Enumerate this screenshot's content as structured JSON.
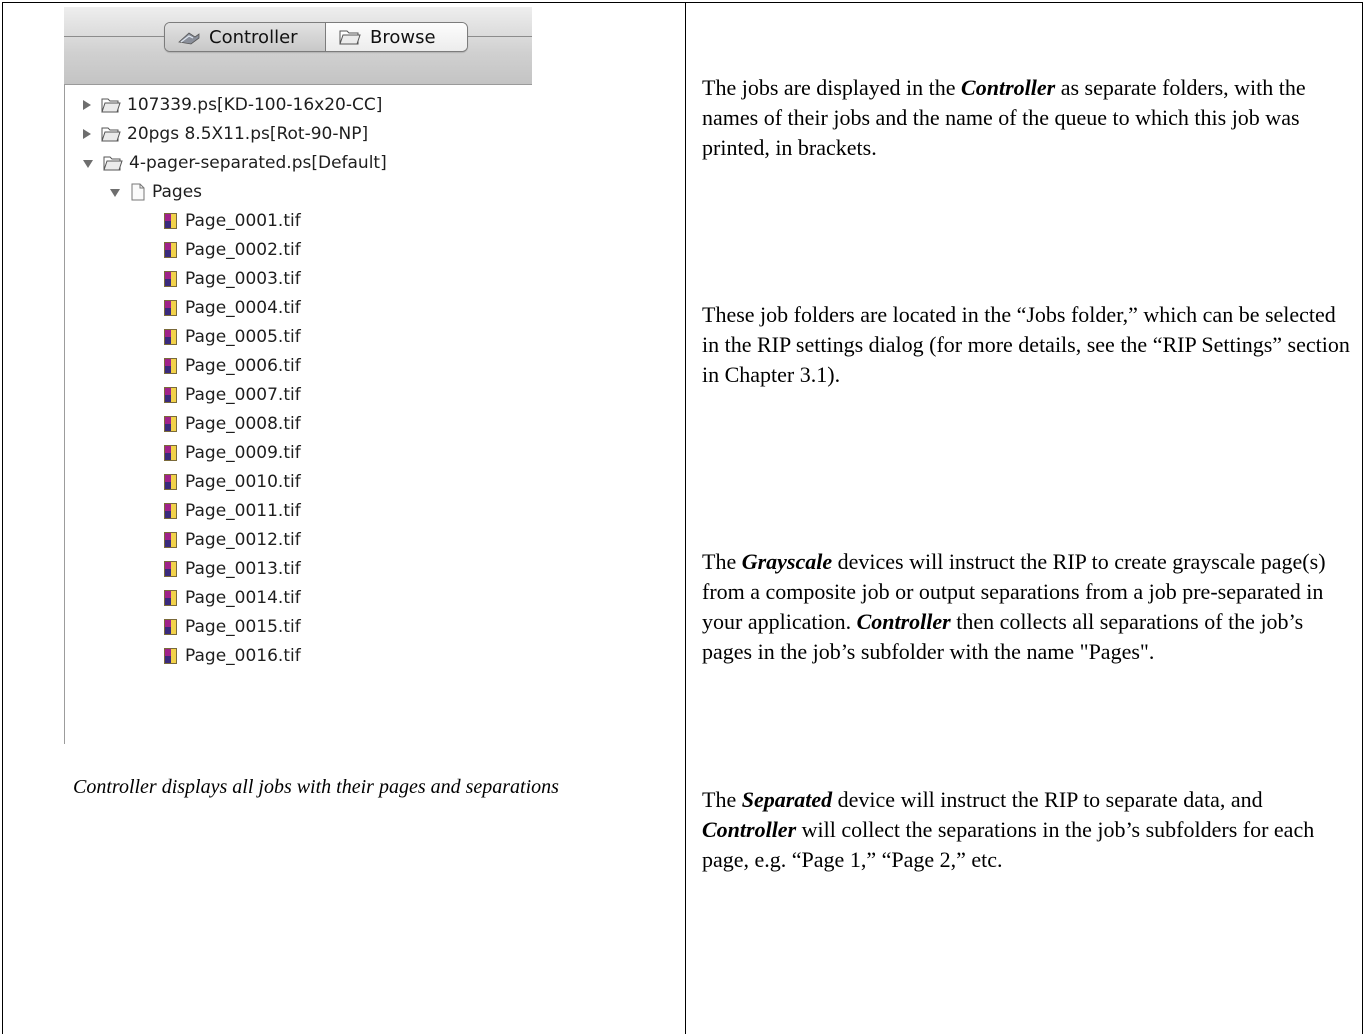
{
  "screenshot": {
    "tabs": [
      {
        "label": "Controller",
        "icon": "controller-icon",
        "selected": true
      },
      {
        "label": "Browse",
        "icon": "folder-icon",
        "selected": false
      }
    ],
    "jobs": [
      {
        "name": "107339.ps[KD-100-16x20-CC]",
        "expanded": false
      },
      {
        "name": "20pgs 8.5X11.ps[Rot-90-NP]",
        "expanded": false
      },
      {
        "name": "4-pager-separated.ps[Default]",
        "expanded": true
      }
    ],
    "pages_folder": "Pages",
    "pages": [
      "Page_0001.tif",
      "Page_0002.tif",
      "Page_0003.tif",
      "Page_0004.tif",
      "Page_0005.tif",
      "Page_0006.tif",
      "Page_0007.tif",
      "Page_0008.tif",
      "Page_0009.tif",
      "Page_0010.tif",
      "Page_0011.tif",
      "Page_0012.tif",
      "Page_0013.tif",
      "Page_0014.tif",
      "Page_0015.tif",
      "Page_0016.tif"
    ]
  },
  "caption": "Controller displays all jobs with their pages and separations",
  "paragraphs": {
    "p1": {
      "a": "The jobs are displayed in the ",
      "b": "Controller",
      "c": " as separate folders, with the names of their jobs and the name of the queue to which this job was printed, in brackets."
    },
    "p2": "These job folders are located in the “Jobs folder,” which can be selected in the RIP settings dialog (for more details, see the “RIP Settings” section in Chapter 3.1).",
    "p3": {
      "a": "The ",
      "b": "Grayscale",
      "c": " devices will instruct the RIP to create grayscale page(s) from a composite job or output separations from a job pre-separated in your application. ",
      "d": "Controller",
      "e": " then collects all separations of the job’s pages in the job’s subfolder with the name \"Pages\"."
    },
    "p4": {
      "a": "The ",
      "b": "Separated",
      "c": " device will instruct the RIP to separate data, and ",
      "d": "Controller",
      "e": " will collect the separations in the job’s subfolders for each page, e.g. “Page 1,” “Page 2,” etc."
    }
  }
}
